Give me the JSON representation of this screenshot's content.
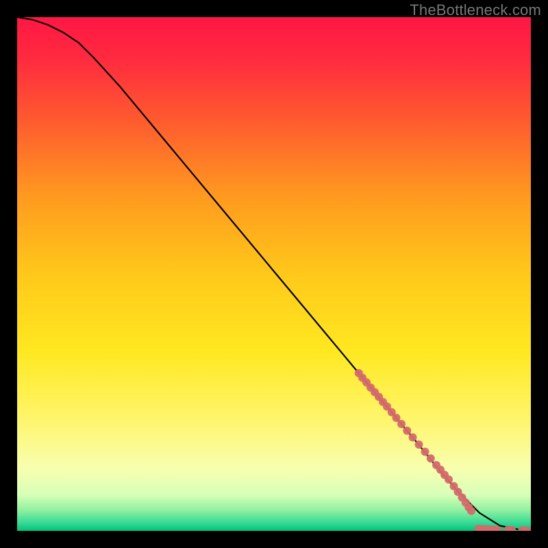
{
  "watermark": "TheBottleneck.com",
  "chart_data": {
    "type": "line",
    "title": "",
    "xlabel": "",
    "ylabel": "",
    "xlim": [
      0,
      100
    ],
    "ylim": [
      0,
      100
    ],
    "background_gradient": {
      "stops": [
        {
          "offset": 0.0,
          "color": "#ff1744"
        },
        {
          "offset": 0.08,
          "color": "#ff2a3f"
        },
        {
          "offset": 0.2,
          "color": "#ff5a2f"
        },
        {
          "offset": 0.35,
          "color": "#ff9a1f"
        },
        {
          "offset": 0.5,
          "color": "#ffc81a"
        },
        {
          "offset": 0.65,
          "color": "#ffe820"
        },
        {
          "offset": 0.78,
          "color": "#fff56a"
        },
        {
          "offset": 0.88,
          "color": "#f7ffb0"
        },
        {
          "offset": 0.93,
          "color": "#d7ffb8"
        },
        {
          "offset": 0.96,
          "color": "#8ff0a0"
        },
        {
          "offset": 0.985,
          "color": "#35d994"
        },
        {
          "offset": 1.0,
          "color": "#00c27a"
        }
      ]
    },
    "series": [
      {
        "name": "curve",
        "type": "line",
        "color": "#000000",
        "x": [
          0,
          3,
          6,
          9,
          12,
          15,
          20,
          30,
          40,
          50,
          60,
          70,
          78,
          82,
          86,
          90,
          94,
          98,
          100
        ],
        "y": [
          100,
          99.5,
          98.5,
          97.0,
          95.0,
          92.0,
          86.5,
          74.5,
          62.5,
          50.5,
          38.5,
          26.5,
          17.0,
          12.0,
          7.5,
          3.5,
          1.0,
          0.2,
          0.1
        ]
      },
      {
        "name": "points-steep",
        "type": "scatter",
        "color": "#d46a6a",
        "x": [
          66.5,
          67.2,
          68.0,
          68.8,
          69.6,
          70.4,
          71.2,
          72.0,
          72.9,
          73.8,
          74.8,
          75.9,
          77.0,
          78.2,
          79.4,
          80.5,
          81.6,
          82.4,
          83.2,
          84.0
        ],
        "y": [
          30.7,
          29.8,
          28.9,
          27.9,
          27.0,
          26.1,
          25.1,
          24.2,
          23.1,
          22.0,
          20.8,
          19.5,
          18.2,
          16.8,
          15.4,
          14.1,
          12.8,
          11.9,
          10.9,
          10.0
        ]
      },
      {
        "name": "points-lower",
        "type": "scatter",
        "color": "#d46a6a",
        "x": [
          85.0,
          85.8,
          86.6,
          87.3,
          87.9,
          88.4
        ],
        "y": [
          8.7,
          7.6,
          6.5,
          5.5,
          4.6,
          3.9
        ]
      },
      {
        "name": "points-flat",
        "type": "scatter",
        "color": "#d46a6a",
        "x": [
          89.8,
          90.5,
          91.2,
          91.9,
          92.6,
          93.5,
          95.5,
          96.3,
          98.3,
          99.2
        ],
        "y": [
          0.4,
          0.35,
          0.3,
          0.28,
          0.25,
          0.22,
          0.18,
          0.16,
          0.12,
          0.1
        ]
      }
    ]
  }
}
